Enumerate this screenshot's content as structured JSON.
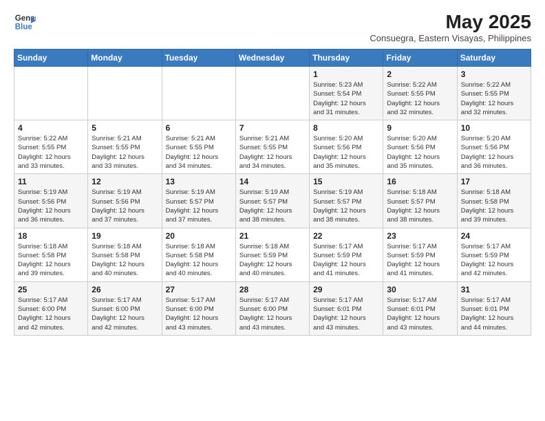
{
  "header": {
    "logo_line1": "General",
    "logo_line2": "Blue",
    "title": "May 2025",
    "subtitle": "Consuegra, Eastern Visayas, Philippines"
  },
  "weekdays": [
    "Sunday",
    "Monday",
    "Tuesday",
    "Wednesday",
    "Thursday",
    "Friday",
    "Saturday"
  ],
  "weeks": [
    [
      {
        "day": "",
        "info": ""
      },
      {
        "day": "",
        "info": ""
      },
      {
        "day": "",
        "info": ""
      },
      {
        "day": "",
        "info": ""
      },
      {
        "day": "1",
        "info": "Sunrise: 5:23 AM\nSunset: 5:54 PM\nDaylight: 12 hours\nand 31 minutes."
      },
      {
        "day": "2",
        "info": "Sunrise: 5:22 AM\nSunset: 5:55 PM\nDaylight: 12 hours\nand 32 minutes."
      },
      {
        "day": "3",
        "info": "Sunrise: 5:22 AM\nSunset: 5:55 PM\nDaylight: 12 hours\nand 32 minutes."
      }
    ],
    [
      {
        "day": "4",
        "info": "Sunrise: 5:22 AM\nSunset: 5:55 PM\nDaylight: 12 hours\nand 33 minutes."
      },
      {
        "day": "5",
        "info": "Sunrise: 5:21 AM\nSunset: 5:55 PM\nDaylight: 12 hours\nand 33 minutes."
      },
      {
        "day": "6",
        "info": "Sunrise: 5:21 AM\nSunset: 5:55 PM\nDaylight: 12 hours\nand 34 minutes."
      },
      {
        "day": "7",
        "info": "Sunrise: 5:21 AM\nSunset: 5:55 PM\nDaylight: 12 hours\nand 34 minutes."
      },
      {
        "day": "8",
        "info": "Sunrise: 5:20 AM\nSunset: 5:56 PM\nDaylight: 12 hours\nand 35 minutes."
      },
      {
        "day": "9",
        "info": "Sunrise: 5:20 AM\nSunset: 5:56 PM\nDaylight: 12 hours\nand 35 minutes."
      },
      {
        "day": "10",
        "info": "Sunrise: 5:20 AM\nSunset: 5:56 PM\nDaylight: 12 hours\nand 36 minutes."
      }
    ],
    [
      {
        "day": "11",
        "info": "Sunrise: 5:19 AM\nSunset: 5:56 PM\nDaylight: 12 hours\nand 36 minutes."
      },
      {
        "day": "12",
        "info": "Sunrise: 5:19 AM\nSunset: 5:56 PM\nDaylight: 12 hours\nand 37 minutes."
      },
      {
        "day": "13",
        "info": "Sunrise: 5:19 AM\nSunset: 5:57 PM\nDaylight: 12 hours\nand 37 minutes."
      },
      {
        "day": "14",
        "info": "Sunrise: 5:19 AM\nSunset: 5:57 PM\nDaylight: 12 hours\nand 38 minutes."
      },
      {
        "day": "15",
        "info": "Sunrise: 5:19 AM\nSunset: 5:57 PM\nDaylight: 12 hours\nand 38 minutes."
      },
      {
        "day": "16",
        "info": "Sunrise: 5:18 AM\nSunset: 5:57 PM\nDaylight: 12 hours\nand 38 minutes."
      },
      {
        "day": "17",
        "info": "Sunrise: 5:18 AM\nSunset: 5:58 PM\nDaylight: 12 hours\nand 39 minutes."
      }
    ],
    [
      {
        "day": "18",
        "info": "Sunrise: 5:18 AM\nSunset: 5:58 PM\nDaylight: 12 hours\nand 39 minutes."
      },
      {
        "day": "19",
        "info": "Sunrise: 5:18 AM\nSunset: 5:58 PM\nDaylight: 12 hours\nand 40 minutes."
      },
      {
        "day": "20",
        "info": "Sunrise: 5:18 AM\nSunset: 5:58 PM\nDaylight: 12 hours\nand 40 minutes."
      },
      {
        "day": "21",
        "info": "Sunrise: 5:18 AM\nSunset: 5:59 PM\nDaylight: 12 hours\nand 40 minutes."
      },
      {
        "day": "22",
        "info": "Sunrise: 5:17 AM\nSunset: 5:59 PM\nDaylight: 12 hours\nand 41 minutes."
      },
      {
        "day": "23",
        "info": "Sunrise: 5:17 AM\nSunset: 5:59 PM\nDaylight: 12 hours\nand 41 minutes."
      },
      {
        "day": "24",
        "info": "Sunrise: 5:17 AM\nSunset: 5:59 PM\nDaylight: 12 hours\nand 42 minutes."
      }
    ],
    [
      {
        "day": "25",
        "info": "Sunrise: 5:17 AM\nSunset: 6:00 PM\nDaylight: 12 hours\nand 42 minutes."
      },
      {
        "day": "26",
        "info": "Sunrise: 5:17 AM\nSunset: 6:00 PM\nDaylight: 12 hours\nand 42 minutes."
      },
      {
        "day": "27",
        "info": "Sunrise: 5:17 AM\nSunset: 6:00 PM\nDaylight: 12 hours\nand 43 minutes."
      },
      {
        "day": "28",
        "info": "Sunrise: 5:17 AM\nSunset: 6:00 PM\nDaylight: 12 hours\nand 43 minutes."
      },
      {
        "day": "29",
        "info": "Sunrise: 5:17 AM\nSunset: 6:01 PM\nDaylight: 12 hours\nand 43 minutes."
      },
      {
        "day": "30",
        "info": "Sunrise: 5:17 AM\nSunset: 6:01 PM\nDaylight: 12 hours\nand 43 minutes."
      },
      {
        "day": "31",
        "info": "Sunrise: 5:17 AM\nSunset: 6:01 PM\nDaylight: 12 hours\nand 44 minutes."
      }
    ]
  ]
}
